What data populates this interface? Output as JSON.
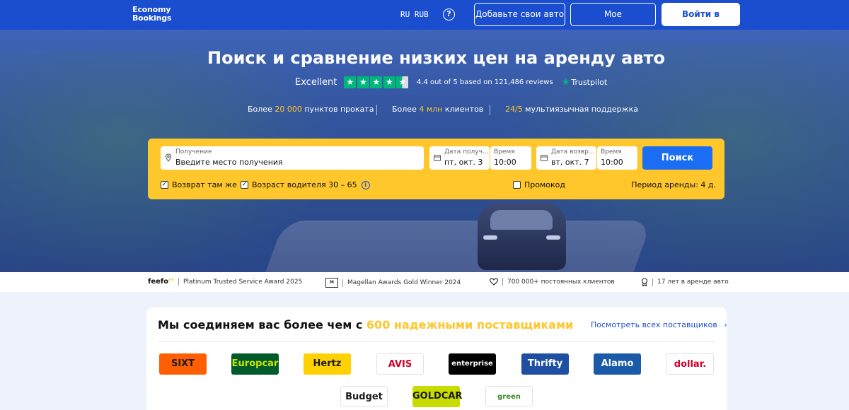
{
  "header": {
    "logo_line1": "Economy",
    "logo_line2": "Bookings",
    "language": "RU",
    "currency": "RUB",
    "help_icon": "question-circle-icon",
    "add_car_label": "Добавьте свои авто",
    "my_booking_label": "Мое бронирование",
    "login_label": "Войти в аккаунт"
  },
  "hero": {
    "title": "Поиск и сравнение низких цен на аренду авто",
    "rating": {
      "label": "Excellent",
      "stars": 4.4,
      "summary": "4.4 out of 5 based on 121,486 reviews",
      "provider": "Trustpilot"
    },
    "stats": [
      {
        "prefix": "Более ",
        "highlight": "20 000",
        "suffix": " пунктов проката"
      },
      {
        "prefix": "Более ",
        "highlight": "4 млн",
        "suffix": " клиентов"
      },
      {
        "prefix": "",
        "highlight": "24/5",
        "suffix": " мультиязычная поддержка"
      }
    ]
  },
  "search": {
    "pickup_label": "Получение",
    "pickup_placeholder": "Введите место получения",
    "pickup_date_label": "Дата получ...",
    "pickup_date": "пт, окт. 3",
    "pickup_time_label": "Время",
    "pickup_time": "10:00",
    "return_date_label": "Дата возвр...",
    "return_date": "вт, окт. 7",
    "return_time_label": "Время",
    "return_time": "10:00",
    "search_label": "Поиск",
    "same_return_label": "Возврат там же",
    "driver_age_label": "Возраст водителя 30 – 65",
    "promo_label": "Промокод",
    "period_label": "Период аренды: 4 д."
  },
  "awards": [
    {
      "logo": "feefo",
      "text": "Platinum Trusted Service Award 2025"
    },
    {
      "logo": "magellan",
      "text": "Magellan Awards Gold Winner 2024"
    },
    {
      "logo": "heart-icon",
      "text": "700 000+ постоянных клиентов"
    },
    {
      "logo": "medal-icon",
      "text": "17 лет в аренде авто"
    }
  ],
  "suppliers": {
    "title_prefix": "Мы соединяем вас более чем с ",
    "title_highlight": "600 надежными поставщиками",
    "see_all_label": "Посмотреть всех поставщиков",
    "logos": [
      {
        "name": "SIXT",
        "bg": "#ff5f00",
        "fg": "#1a1a1a"
      },
      {
        "name": "Europcar",
        "bg": "#005a2b",
        "fg": "#c8e600"
      },
      {
        "name": "Hertz",
        "bg": "#ffd100",
        "fg": "#1a1a1a"
      },
      {
        "name": "AVIS",
        "bg": "#ffffff",
        "fg": "#d4002a"
      },
      {
        "name": "enterprise",
        "bg": "#000000",
        "fg": "#ffffff"
      },
      {
        "name": "Thrifty",
        "bg": "#1f4fa3",
        "fg": "#ffffff"
      },
      {
        "name": "Alamo",
        "bg": "#1a5aa8",
        "fg": "#ffffff"
      },
      {
        "name": "dollar.",
        "bg": "#ffffff",
        "fg": "#d4002a"
      },
      {
        "name": "Budget",
        "bg": "#ffffff",
        "fg": "#1a1a1a"
      },
      {
        "name": "GOLDCAR",
        "bg": "#c8dc00",
        "fg": "#1a1a1a"
      },
      {
        "name": "green motion",
        "bg": "#ffffff",
        "fg": "#3a8a2a"
      }
    ]
  }
}
